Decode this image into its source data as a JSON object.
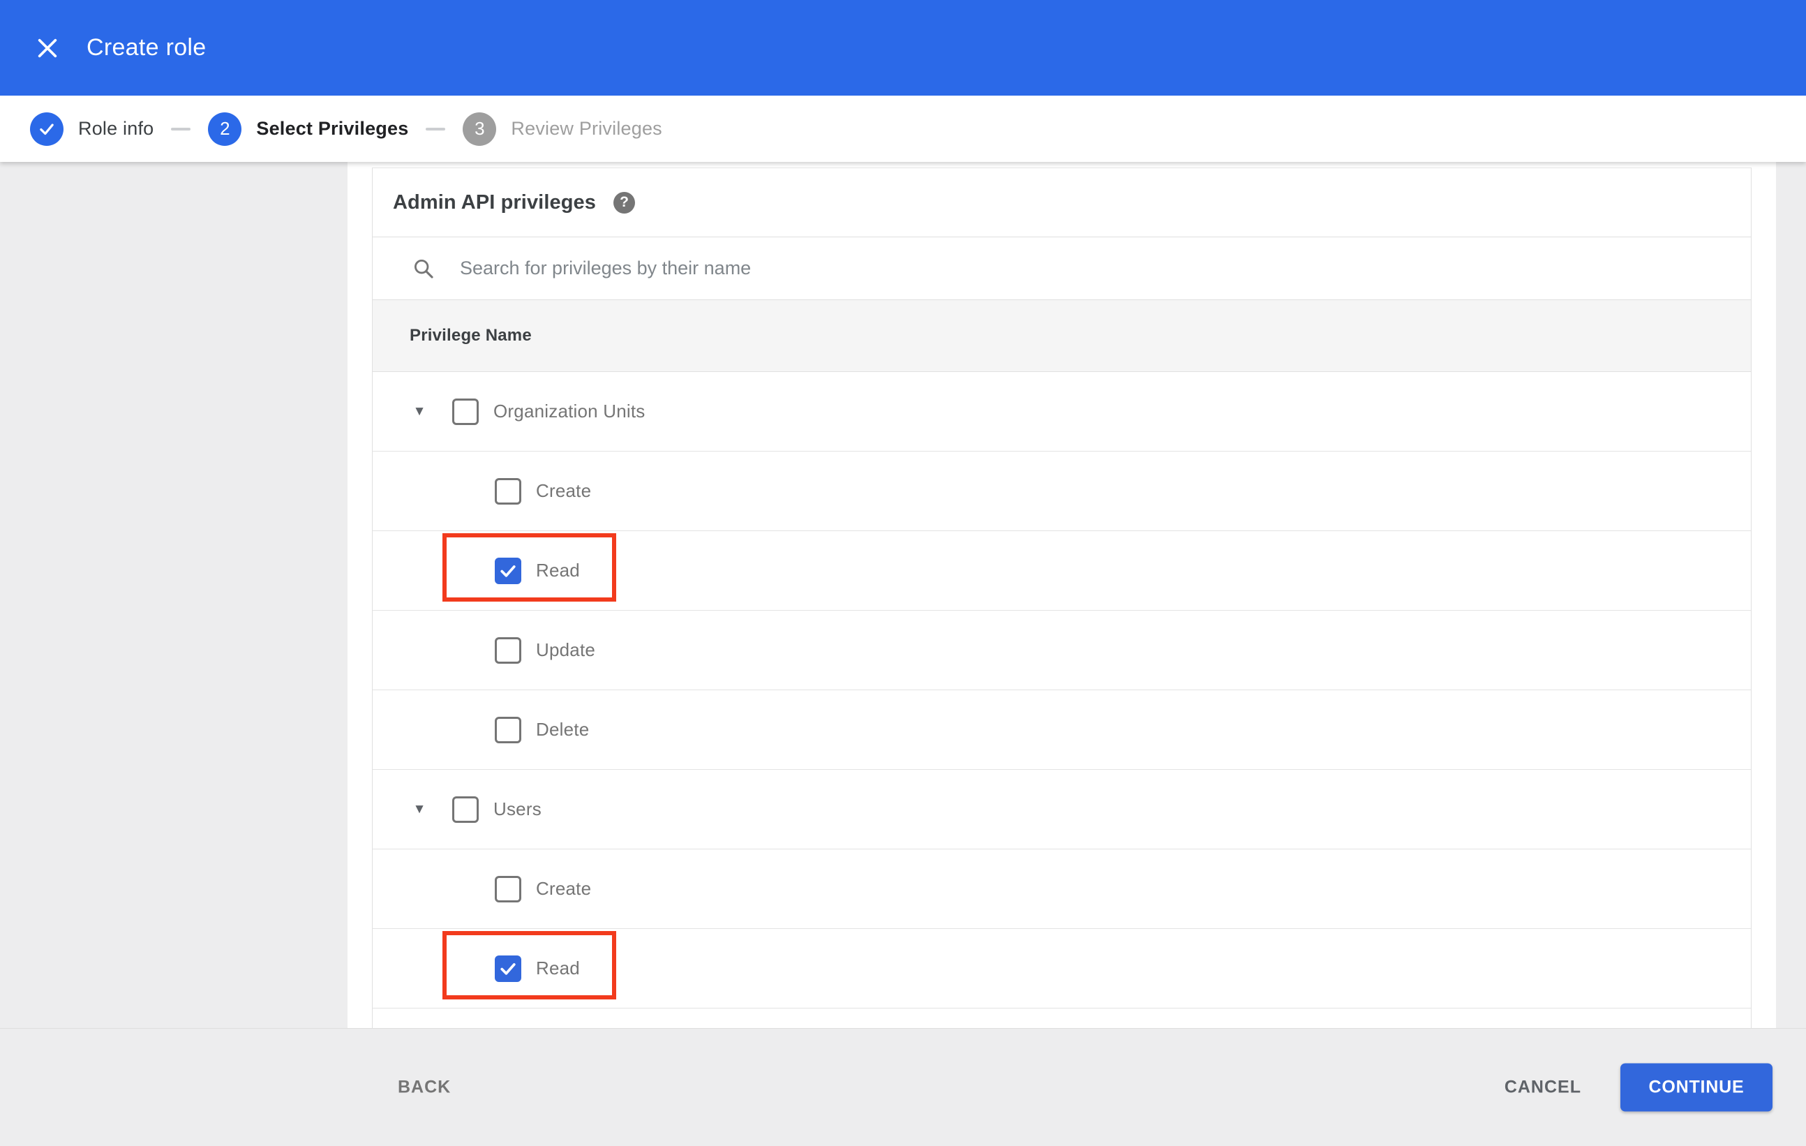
{
  "app_bar": {
    "title": "Create role",
    "close_icon": "close-icon"
  },
  "stepper": {
    "steps": [
      {
        "indicator": "check",
        "label": "Role info",
        "status": "done"
      },
      {
        "indicator": "2",
        "label": "Select Privileges",
        "status": "active"
      },
      {
        "indicator": "3",
        "label": "Review Privileges",
        "status": "upcoming"
      }
    ]
  },
  "content": {
    "heading": "Admin API privileges",
    "help_icon": "?",
    "search": {
      "placeholder": "Search for privileges by their name",
      "value": ""
    },
    "table": {
      "header": "Privilege Name",
      "rows": [
        {
          "label": "Organization Units",
          "level": 0,
          "expandable": true,
          "checked": false,
          "highlighted": false
        },
        {
          "label": "Create",
          "level": 1,
          "expandable": false,
          "checked": false,
          "highlighted": false
        },
        {
          "label": "Read",
          "level": 1,
          "expandable": false,
          "checked": true,
          "highlighted": true
        },
        {
          "label": "Update",
          "level": 1,
          "expandable": false,
          "checked": false,
          "highlighted": false
        },
        {
          "label": "Delete",
          "level": 1,
          "expandable": false,
          "checked": false,
          "highlighted": false
        },
        {
          "label": "Users",
          "level": 0,
          "expandable": true,
          "checked": false,
          "highlighted": false
        },
        {
          "label": "Create",
          "level": 1,
          "expandable": false,
          "checked": false,
          "highlighted": false
        },
        {
          "label": "Read",
          "level": 1,
          "expandable": false,
          "checked": true,
          "highlighted": true
        }
      ]
    }
  },
  "footer": {
    "back_label": "BACK",
    "cancel_label": "CANCEL",
    "continue_label": "CONTINUE"
  },
  "colors": {
    "app_bar_blue": "#2b69e8",
    "control_blue": "#3267dc",
    "highlight_red": "#f23b1d",
    "step_inactive_gray": "#9e9e9e",
    "label_gray": "#757575",
    "heading_gray": "#3c4043",
    "divider": "#e0e0e0",
    "table_head_bg": "#f5f5f5",
    "footer_bg": "#ededee"
  }
}
